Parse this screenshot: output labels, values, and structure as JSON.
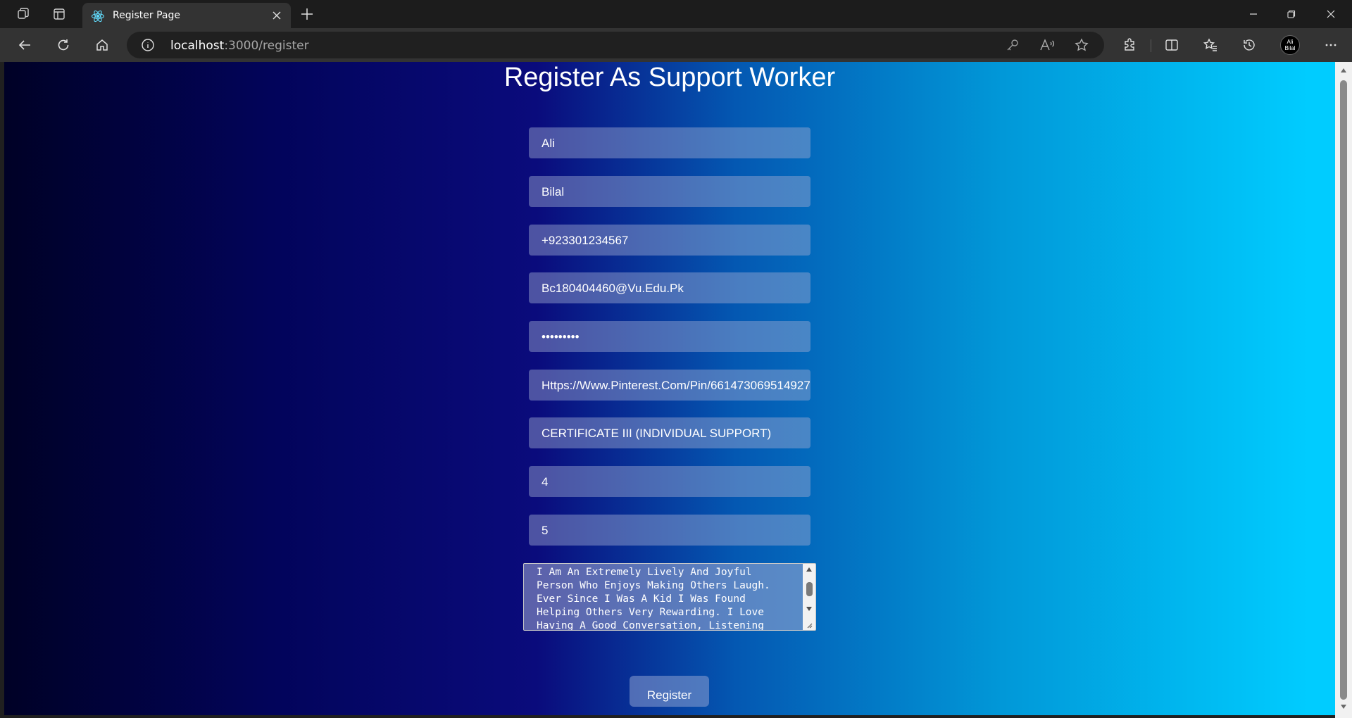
{
  "browser": {
    "tab_title": "Register Page",
    "url_host": "localhost",
    "url_path": ":3000/register",
    "avatar_text": "Ali Bilal"
  },
  "page": {
    "title": "Register As Support Worker",
    "fields": {
      "first_name": "Ali",
      "last_name": "Bilal",
      "phone": "+923301234567",
      "email": "Bc180404460@Vu.Edu.Pk",
      "password": "•••••••••",
      "image_url": "Https://Www.Pinterest.Com/Pin/661473069514927",
      "qualification": "CERTIFICATE III (INDIVIDUAL SUPPORT)",
      "experience": "4",
      "rating": "5",
      "bio": "I Am An Extremely Lively And Joyful\nPerson Who Enjoys Making Others Laugh.\nEver Since I Was A Kid I Was Found\nHelping Others Very Rewarding. I Love\nHaving A Good Conversation, Listening"
    },
    "register_label": "Register"
  }
}
